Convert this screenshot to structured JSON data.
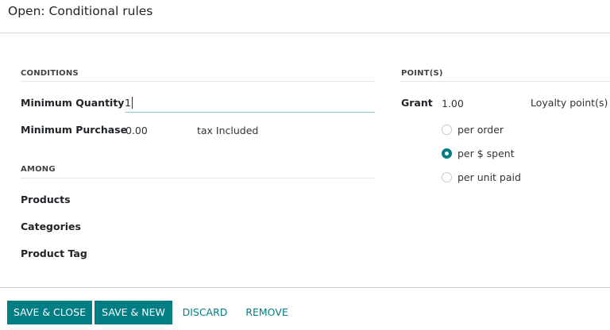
{
  "dialog": {
    "title": "Open: Conditional rules"
  },
  "conditions": {
    "heading": "CONDITIONS",
    "min_quantity_label": "Minimum Quantity",
    "min_quantity_value": "1",
    "min_purchase_label": "Minimum Purchase",
    "min_purchase_value": "0.00",
    "tax_mode": "tax Included"
  },
  "among": {
    "heading": "AMONG",
    "products_label": "Products",
    "categories_label": "Categories",
    "product_tag_label": "Product Tag"
  },
  "points": {
    "heading": "POINT(S)",
    "grant_label": "Grant",
    "grant_value": "1.00",
    "unit": "Loyalty point(s)",
    "options": [
      "per order",
      "per $ spent",
      "per unit paid"
    ],
    "selected": "per $ spent"
  },
  "footer": {
    "save_close": "SAVE & CLOSE",
    "save_new": "SAVE & NEW",
    "discard": "DISCARD",
    "remove": "REMOVE"
  },
  "colors": {
    "accent": "#017e84"
  }
}
